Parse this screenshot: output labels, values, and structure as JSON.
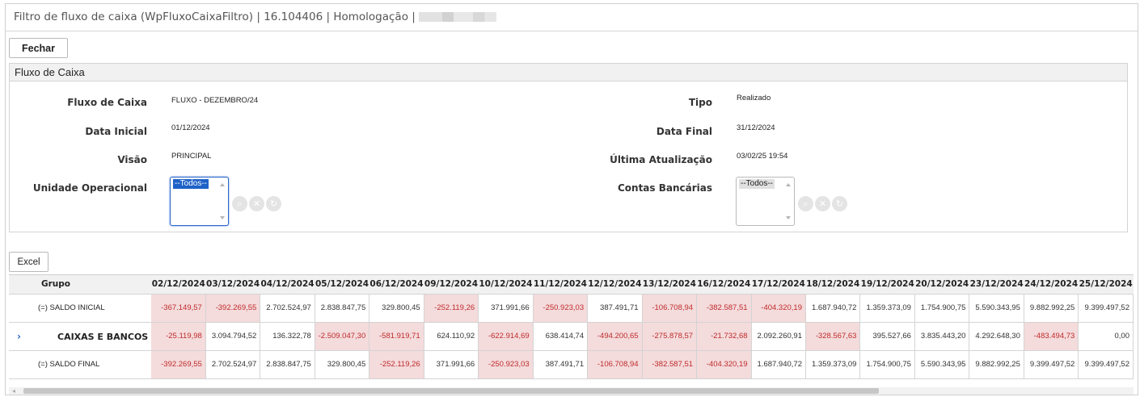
{
  "window": {
    "title": "Filtro de fluxo de caixa (WpFluxoCaixaFiltro) | 16.104406 | Homologação |"
  },
  "toolbar": {
    "close_label": "Fechar",
    "excel_label": "Excel"
  },
  "panel": {
    "title": "Fluxo de Caixa",
    "fields": {
      "fluxo_caixa": {
        "label": "Fluxo de Caixa",
        "value": "FLUXO - DEZEMBRO/24"
      },
      "tipo": {
        "label": "Tipo",
        "value": "Realizado"
      },
      "data_inicial": {
        "label": "Data Inicial",
        "value": "01/12/2024"
      },
      "data_final": {
        "label": "Data Final",
        "value": "31/12/2024"
      },
      "visao": {
        "label": "Visão",
        "value": "PRINCIPAL"
      },
      "ultima_atualizacao": {
        "label": "Última Atualização",
        "value": "03/02/25 19:54"
      },
      "unidade_operacional": {
        "label": "Unidade Operacional",
        "selected": "--Todos--"
      },
      "contas_bancarias": {
        "label": "Contas Bancárias",
        "selected": "--Todos--"
      }
    },
    "action_icons": [
      "search-icon",
      "clear-icon",
      "refresh-icon"
    ]
  },
  "colors": {
    "negative_bg": "#f4dbdc",
    "negative_text": "#c02b2b",
    "header_bg": "#f1f1f1",
    "focus_blue": "#1e62c8"
  },
  "grid": {
    "group_header": "Grupo",
    "columns": [
      "02/12/2024",
      "03/12/2024",
      "04/12/2024",
      "05/12/2024",
      "06/12/2024",
      "09/12/2024",
      "10/12/2024",
      "11/12/2024",
      "12/12/2024",
      "13/12/2024",
      "16/12/2024",
      "17/12/2024",
      "18/12/2024",
      "19/12/2024",
      "20/12/2024",
      "23/12/2024",
      "24/12/2024",
      "25/12/2024"
    ],
    "rows": [
      {
        "group": "(=) SALDO INICIAL",
        "expandable": false,
        "values": [
          "-367.149,57",
          "-392.269,55",
          "2.702.524,97",
          "2.838.847,75",
          "329.800,45",
          "-252.119,26",
          "371.991,66",
          "-250.923,03",
          "387.491,71",
          "-106.708,94",
          "-382.587,51",
          "-404.320,19",
          "1.687.940,72",
          "1.359.373,09",
          "1.754.900,75",
          "5.590.343,95",
          "9.882.992,25",
          "9.399.497,52"
        ]
      },
      {
        "group": "CAIXAS E BANCOS",
        "expandable": true,
        "expand_icon": "chevron-right-icon",
        "values": [
          "-25.119,98",
          "3.094.794,52",
          "136.322,78",
          "-2.509.047,30",
          "-581.919,71",
          "624.110,92",
          "-622.914,69",
          "638.414,74",
          "-494.200,65",
          "-275.878,57",
          "-21.732,68",
          "2.092.260,91",
          "-328.567,63",
          "395.527,66",
          "3.835.443,20",
          "4.292.648,30",
          "-483.494,73",
          "0,00"
        ]
      },
      {
        "group": "(=) SALDO FINAL",
        "expandable": false,
        "values": [
          "-392.269,55",
          "2.702.524,97",
          "2.838.847,75",
          "329.800,45",
          "-252.119,26",
          "371.991,66",
          "-250.923,03",
          "387.491,71",
          "-106.708,94",
          "-382.587,51",
          "-404.320,19",
          "1.687.940,72",
          "1.359.373,09",
          "1.754.900,75",
          "5.590.343,95",
          "9.882.992,25",
          "9.399.497,52",
          "9.399.497,52"
        ]
      }
    ]
  }
}
